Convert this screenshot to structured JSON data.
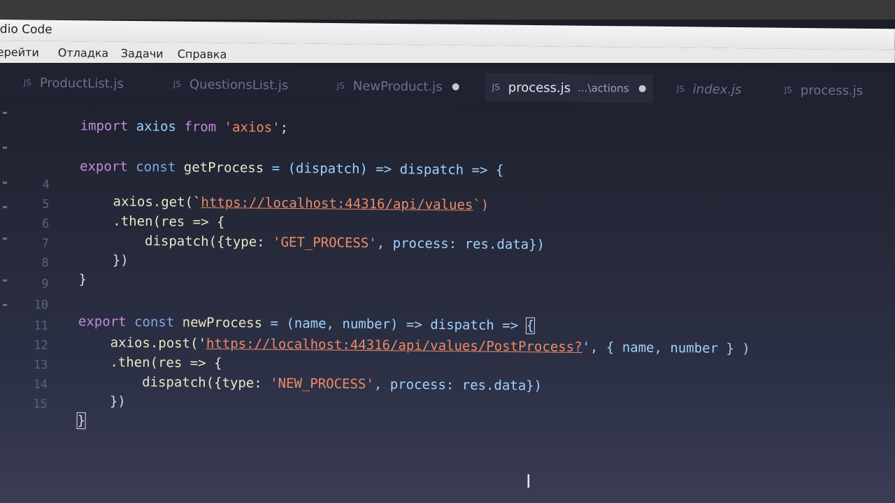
{
  "window": {
    "title": "dio Code"
  },
  "menu": [
    "ерейти",
    "Отладка",
    "Задачи",
    "Справка"
  ],
  "tabs": [
    {
      "name": "ProductList.js",
      "icon": "JS",
      "active": false
    },
    {
      "name": "QuestionsList.js",
      "icon": "JS",
      "active": false
    },
    {
      "name": "NewProduct.js",
      "icon": "JS",
      "active": false,
      "modified": true
    },
    {
      "name": "process.js",
      "icon": "JS",
      "active": true,
      "path": "...\\actions",
      "modified": true
    },
    {
      "name": "index.js",
      "icon": "JS",
      "active": false,
      "italic": true
    },
    {
      "name": "process.js",
      "icon": "JS",
      "active": false
    }
  ],
  "code": {
    "line_numbers": [
      "4",
      "5",
      "6",
      "7",
      "8",
      "9",
      "10",
      "11",
      "12",
      "13",
      "14",
      "15"
    ],
    "l1": {
      "kw": "import",
      "a": " axios ",
      "b": "from",
      "c": " ",
      "s": "'axios'",
      "d": ";"
    },
    "l3": {
      "kw": "export",
      "k2": " const ",
      "fn": "getProcess",
      "rest": " = (dispatch) => dispatch => {"
    },
    "l4": {
      "pre": "axios.get(`",
      "url": "https://localhost:44316/api/values",
      "post": "`)"
    },
    "l5": {
      "text": ".then(res => {"
    },
    "l6": {
      "pre": "dispatch({type: ",
      "s": "'GET_PROCESS'",
      "post": ", process: res.data})"
    },
    "l7": {
      "text": "})"
    },
    "l8": {
      "text": "}"
    },
    "l10": {
      "kw": "export",
      "k2": " const ",
      "fn": "newProcess",
      "rest": " = (name, number) => dispatch => ",
      "brace": "{"
    },
    "l11": {
      "pre": "axios.post('",
      "url": "https://localhost:44316/api/values/PostProcess?",
      "post": "', { name, number } )"
    },
    "l12": {
      "text": ".then(res => {"
    },
    "l13": {
      "pre": "dispatch({type: ",
      "s": "'NEW_PROCESS'",
      "post": ", process: res.data})"
    },
    "l14": {
      "text": "})"
    },
    "l15": {
      "text": "}"
    }
  },
  "colors": {
    "background": "#252838",
    "keyword": "#c48bdc",
    "string": "#ee8a6a",
    "function": "#e8e6c4"
  }
}
